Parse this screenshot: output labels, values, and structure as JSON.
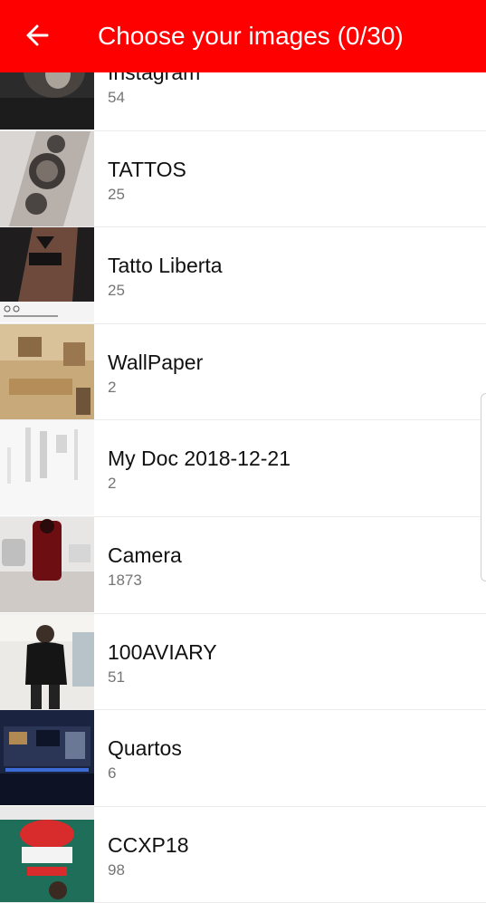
{
  "header": {
    "title": "Choose your images (0/30)",
    "back_icon": "arrow-left-icon",
    "color": "#ff0000"
  },
  "albums": [
    {
      "name": "Instagram",
      "count": "54"
    },
    {
      "name": "TATTOS",
      "count": "25"
    },
    {
      "name": "Tatto Liberta",
      "count": "25"
    },
    {
      "name": "WallPaper",
      "count": "2"
    },
    {
      "name": "My Doc 2018-12-21",
      "count": "2"
    },
    {
      "name": "Camera",
      "count": "1873"
    },
    {
      "name": "100AVIARY",
      "count": "51"
    },
    {
      "name": "Quartos",
      "count": "6"
    },
    {
      "name": "CCXP18",
      "count": "98"
    }
  ]
}
